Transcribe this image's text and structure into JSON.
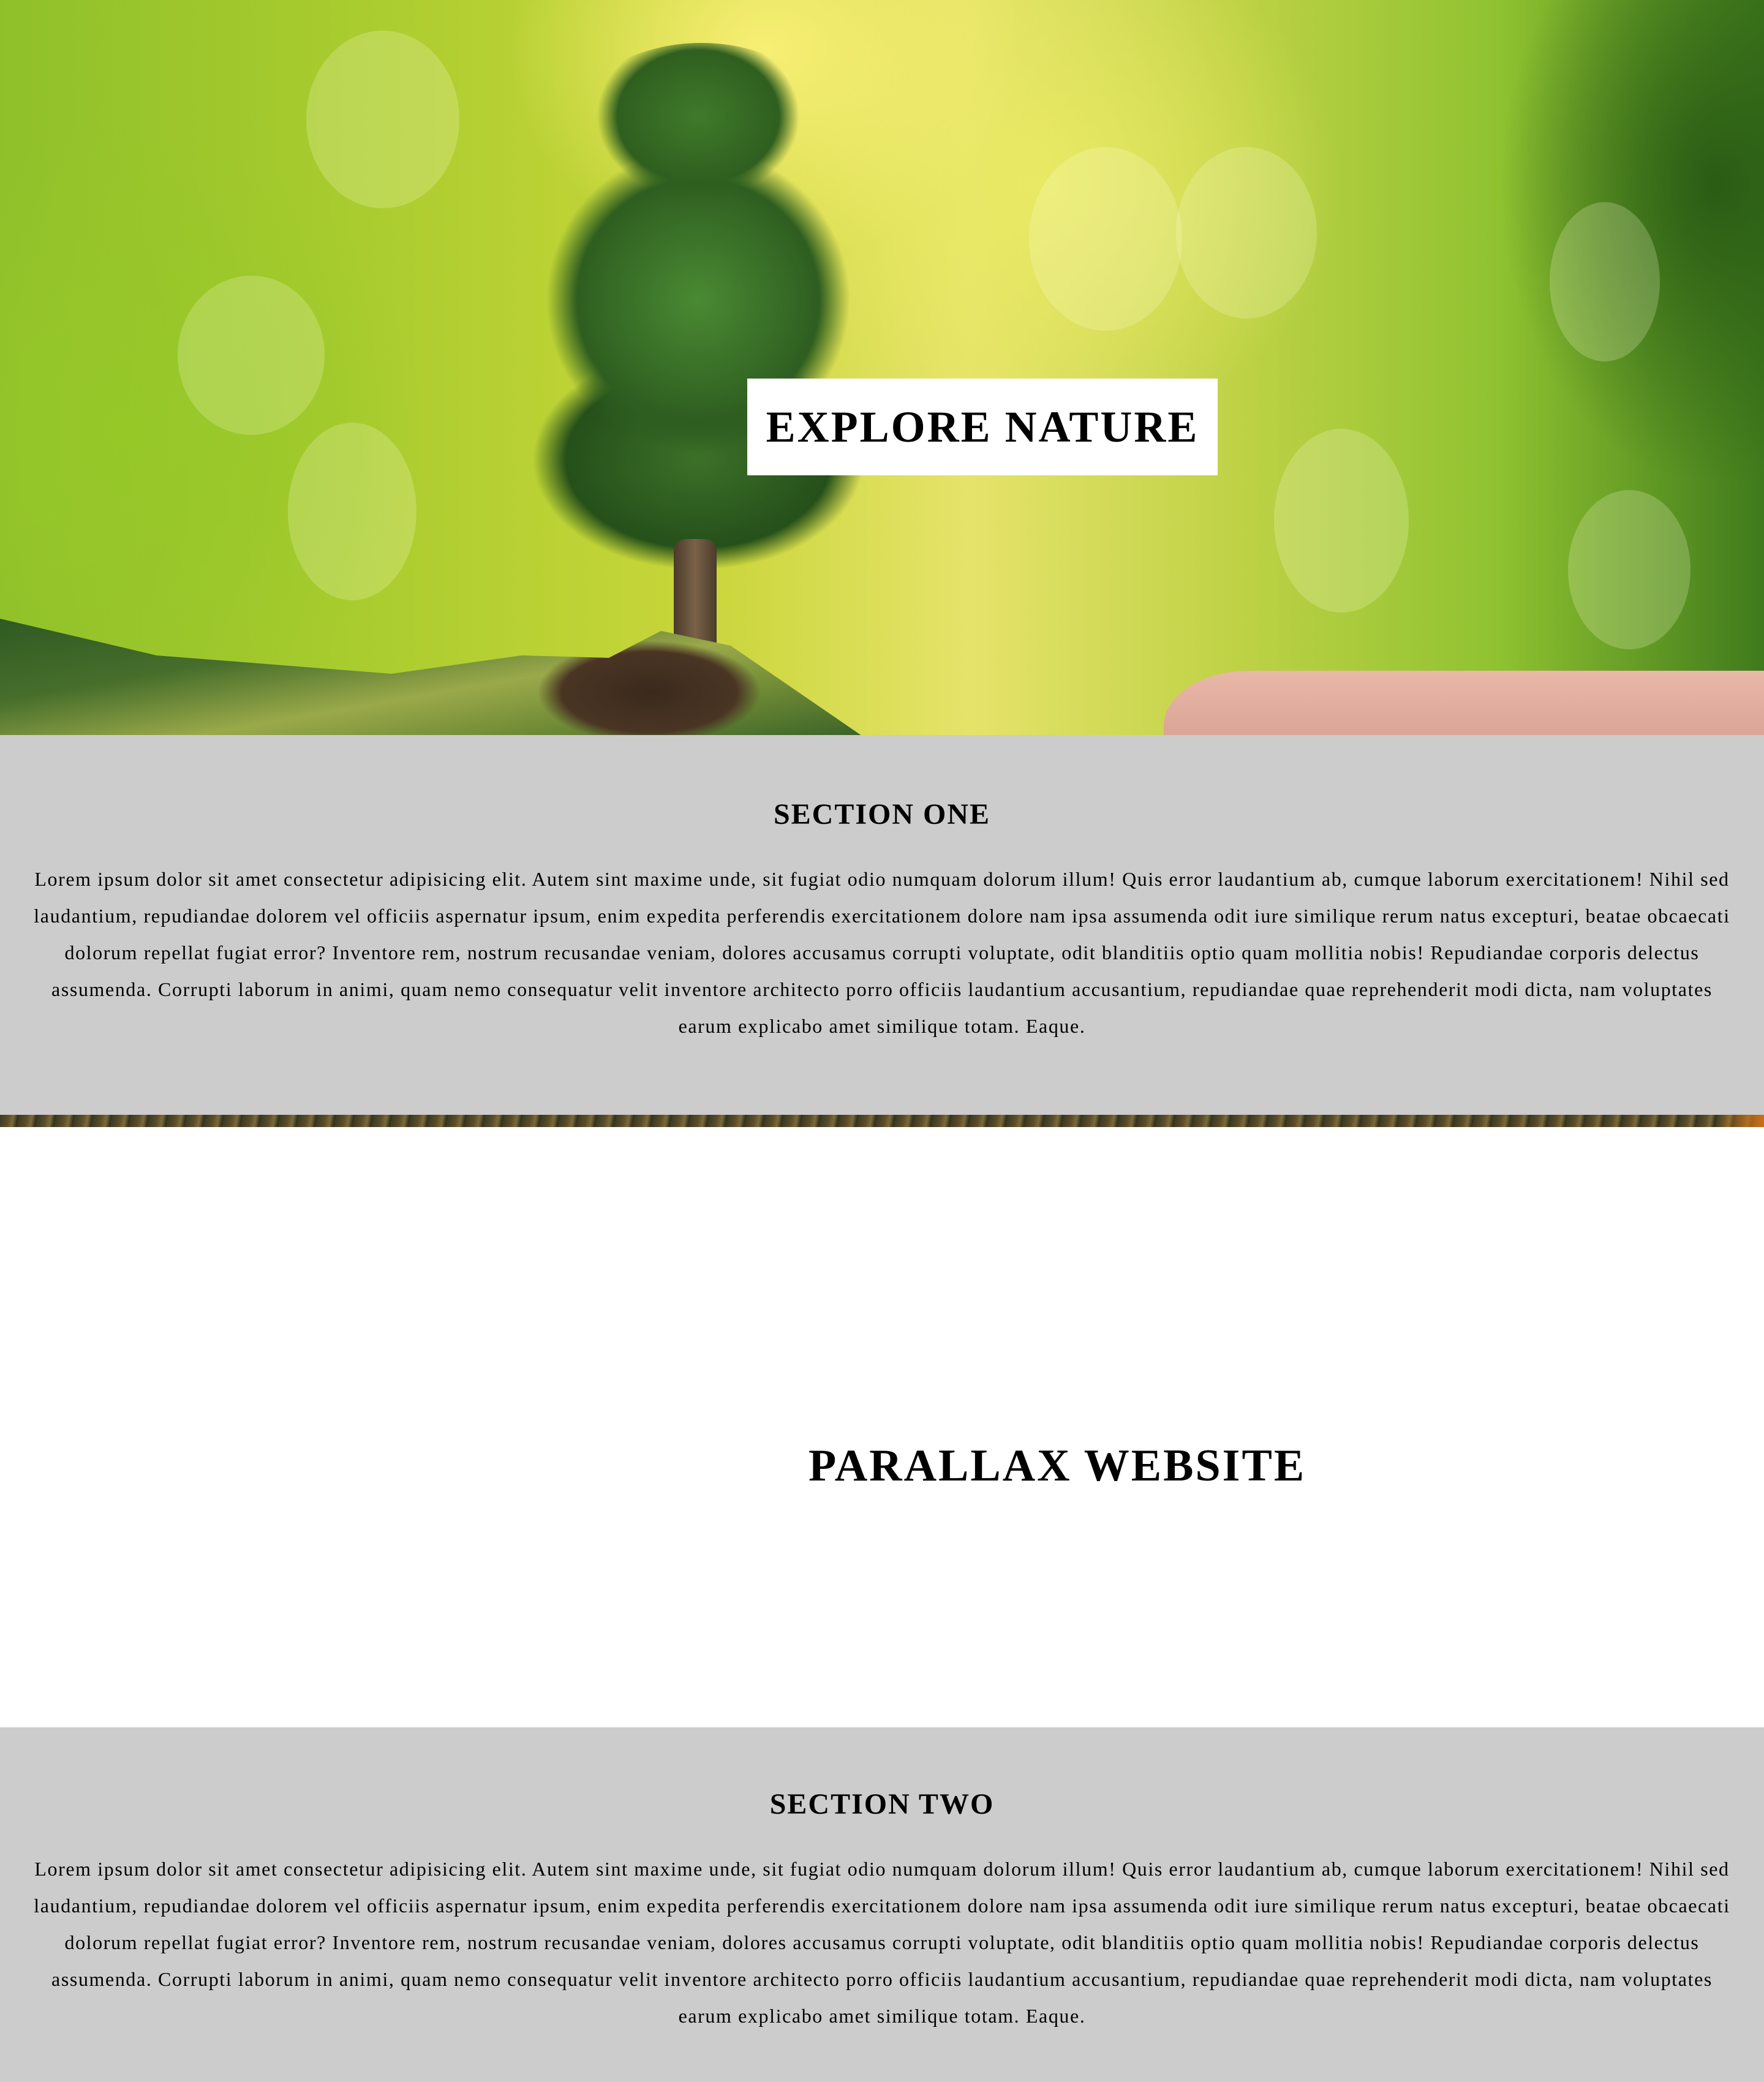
{
  "hero": {
    "title": "EXPLORE NATURE"
  },
  "section_one": {
    "heading": "SECTION ONE",
    "text": "Lorem ipsum dolor sit amet consectetur adipisicing elit. Autem sint maxime unde, sit fugiat odio numquam dolorum illum! Quis error laudantium ab, cumque laborum exercitationem! Nihil sed laudantium, repudiandae dolorem vel officiis aspernatur ipsum, enim expedita perferendis exercitationem dolore nam ipsa assumenda odit iure similique rerum natus excepturi, beatae obcaecati dolorum repellat fugiat error? Inventore rem, nostrum recusandae veniam, dolores accusamus corrupti voluptate, odit blanditiis optio quam mollitia nobis! Repudiandae corporis delectus assumenda. Corrupti laborum in animi, quam nemo consequatur velit inventore architecto porro officiis laudantium accusantium, repudiandae quae reprehenderit modi dicta, nam voluptates earum explicabo amet similique totam. Eaque."
  },
  "parallax": {
    "title": "PARALLAX WEBSITE"
  },
  "section_two": {
    "heading": "SECTION TWO",
    "text": "Lorem ipsum dolor sit amet consectetur adipisicing elit. Autem sint maxime unde, sit fugiat odio numquam dolorum illum! Quis error laudantium ab, cumque laborum exercitationem! Nihil sed laudantium, repudiandae dolorem vel officiis aspernatur ipsum, enim expedita perferendis exercitationem dolore nam ipsa assumenda odit iure similique rerum natus excepturi, beatae obcaecati dolorum repellat fugiat error? Inventore rem, nostrum recusandae veniam, dolores accusamus corrupti voluptate, odit blanditiis optio quam mollitia nobis! Repudiandae corporis delectus assumenda. Corrupti laborum in animi, quam nemo consequatur velit inventore architecto porro officiis laudantium accusantium, repudiandae quae reprehenderit modi dicta, nam voluptates earum explicabo amet similique totam. Eaque."
  },
  "colors": {
    "section_background": "#cccccc",
    "title_box_background": "#ffffff",
    "text": "#000000"
  }
}
